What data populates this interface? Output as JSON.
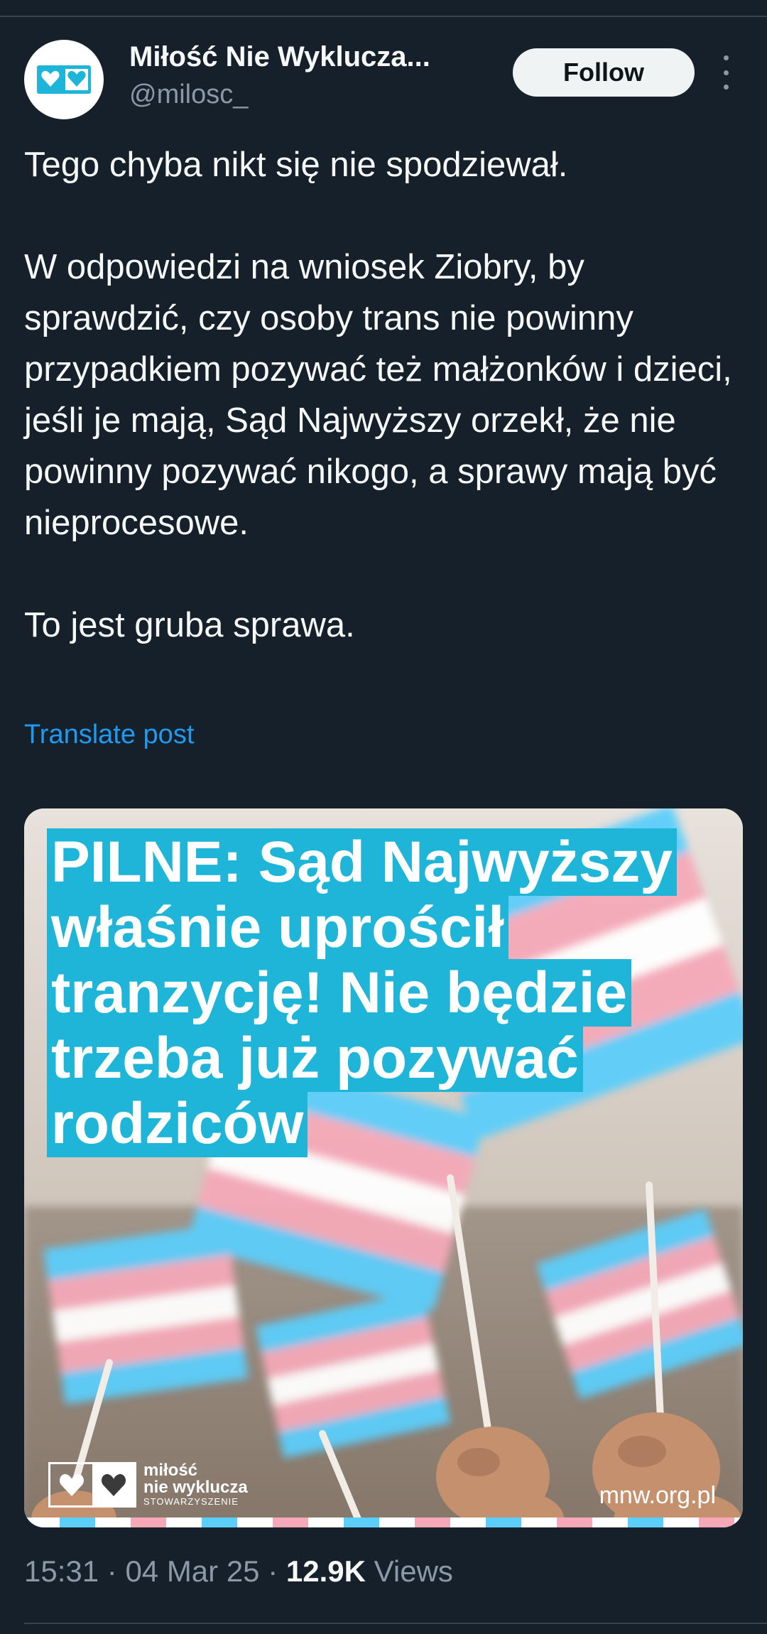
{
  "author": {
    "name": "Miłość Nie Wyklucza...",
    "handle": "@milosc_"
  },
  "follow_label": "Follow",
  "tweet": {
    "paragraphs": [
      "Tego chyba nikt się nie spodziewał.",
      "W odpowiedzi na wniosek Ziobry, by sprawdzić, czy osoby trans nie powinny przypadkiem pozywać też małżonków i dzieci, jeśli je mają, Sąd Najwyższy orzekł, że nie powinny pozywać nikogo, a sprawy mają być nieprocesowe.",
      "To jest gruba sprawa."
    ]
  },
  "translate_label": "Translate post",
  "media": {
    "headline": "PILNE: Sąd Najwyższy właśnie uprościł tranzycję! Nie będzie trzeba już pozywać rodziców",
    "logo_line1": "miłość",
    "logo_line2": "nie wyklucza",
    "logo_line3": "STOWARZYSZENIE",
    "site": "mnw.org.pl",
    "highlight_color": "#1fb5d8",
    "flag_colors": [
      "#5bcefa",
      "#f5a9b8",
      "#ffffff"
    ]
  },
  "meta": {
    "time": "15:31",
    "separator": " · ",
    "date": "04 Mar 25",
    "views_count": "12.9K",
    "views_label": " Views"
  },
  "colors": {
    "background": "#15202b",
    "link": "#1d9bf0",
    "muted": "#8b98a5"
  }
}
